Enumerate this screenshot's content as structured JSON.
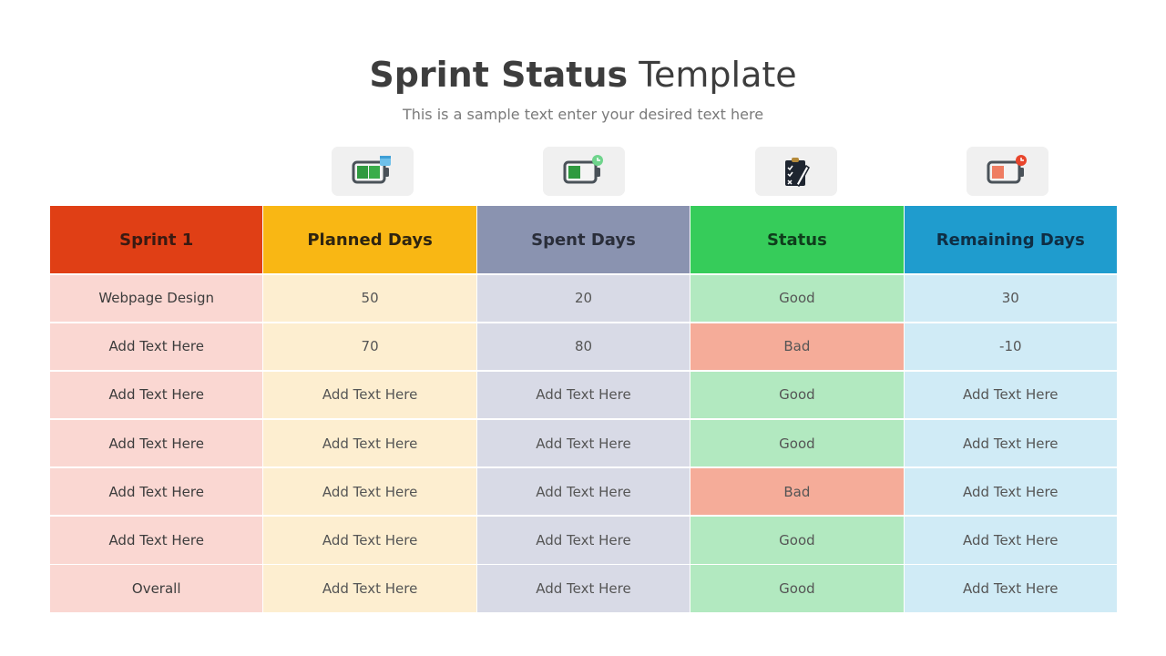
{
  "header": {
    "title_bold": "Sprint Status",
    "title_light": "Template",
    "subtitle": "This is a sample text enter your desired text here"
  },
  "icons": [
    {
      "name": "battery-full-calendar-icon",
      "column": "Planned Days"
    },
    {
      "name": "battery-half-clock-icon",
      "column": "Spent Days"
    },
    {
      "name": "clipboard-checklist-pen-icon",
      "column": "Status"
    },
    {
      "name": "battery-low-alarm-icon",
      "column": "Remaining Days"
    }
  ],
  "colors": {
    "sprint": "#e03f15",
    "planned": "#f9b714",
    "spent": "#8a93b0",
    "status": "#36cc5a",
    "remaining": "#1f9cce",
    "good": "#b2e9c0",
    "bad": "#f5ac99"
  },
  "table": {
    "columns": [
      "Sprint 1",
      "Planned Days",
      "Spent Days",
      "Status",
      "Remaining Days"
    ],
    "rows": [
      [
        "Webpage Design",
        "50",
        "20",
        "Good",
        "30"
      ],
      [
        "Add Text Here",
        "70",
        "80",
        "Bad",
        "-10"
      ],
      [
        "Add Text Here",
        "Add Text Here",
        "Add Text Here",
        "Good",
        "Add Text Here"
      ],
      [
        "Add Text Here",
        "Add Text Here",
        "Add Text Here",
        "Good",
        "Add Text Here"
      ],
      [
        "Add Text Here",
        "Add Text Here",
        "Add Text Here",
        "Bad",
        "Add Text Here"
      ],
      [
        "Add Text Here",
        "Add Text Here",
        "Add Text Here",
        "Good",
        "Add Text Here"
      ],
      [
        "Overall",
        "Add Text Here",
        "Add Text Here",
        "Good",
        "Add Text Here"
      ]
    ]
  }
}
